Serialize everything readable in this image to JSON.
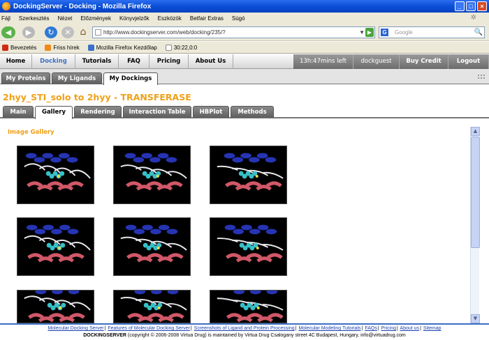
{
  "window": {
    "title": "DockingServer - Docking - Mozilla Firefox"
  },
  "menu": [
    "Fájl",
    "Szerkesztés",
    "Nézet",
    "Előzmények",
    "Könyvjelzők",
    "Eszközök",
    "Betfair Extras",
    "Súgó"
  ],
  "nav": {
    "url": "http://www.dockingserver.com/web/docking/235/?",
    "search_placeholder": "Google"
  },
  "bookmarks": [
    "Bevezetés",
    "Friss hírek",
    "Mozilla Firefox Kezdőlap",
    "30:22,0:0"
  ],
  "site_nav": {
    "items": [
      "Home",
      "Docking",
      "Tutorials",
      "FAQ",
      "Pricing",
      "About Us"
    ],
    "active": "Docking",
    "time_left": "13h:47mins left",
    "user": "dockguest",
    "buy_credit": "Buy Credit",
    "logout": "Logout"
  },
  "subtabs": [
    "My Proteins",
    "My Ligands",
    "My Dockings"
  ],
  "page": {
    "title": "2hyy_STI_solo to 2hyy - TRANSFERASE",
    "section": "Image Gallery"
  },
  "detail_tabs": [
    "Main",
    "Gallery",
    "Rendering",
    "Interaction Table",
    "HBPlot",
    "Methods"
  ],
  "gallery": {
    "images": [
      "protein-render-1",
      "protein-render-2",
      "protein-render-3",
      "protein-render-4",
      "protein-render-5",
      "protein-render-6",
      "protein-render-7",
      "protein-render-8",
      "protein-render-9"
    ]
  },
  "footer": {
    "links": [
      "Molecular Docking Server",
      "Features of Molecular Docking Server",
      "Screenshots of Ligand and Protein Processing",
      "Molecular Modeling Tutorials",
      "FAQs",
      "Pricing",
      "About us",
      "Sitemap"
    ],
    "brand": "DOCKINGSERVER",
    "copyright": "(copyright © 2006-2008 Virtua Drug) is maintained by Virtua Drug Csalogany street 4C Budapest, Hungary, info@virtuadrug.com"
  },
  "colors": {
    "accent": "#f0a018",
    "link": "#1a3fb0",
    "nav_active": "#3a6fc4"
  }
}
